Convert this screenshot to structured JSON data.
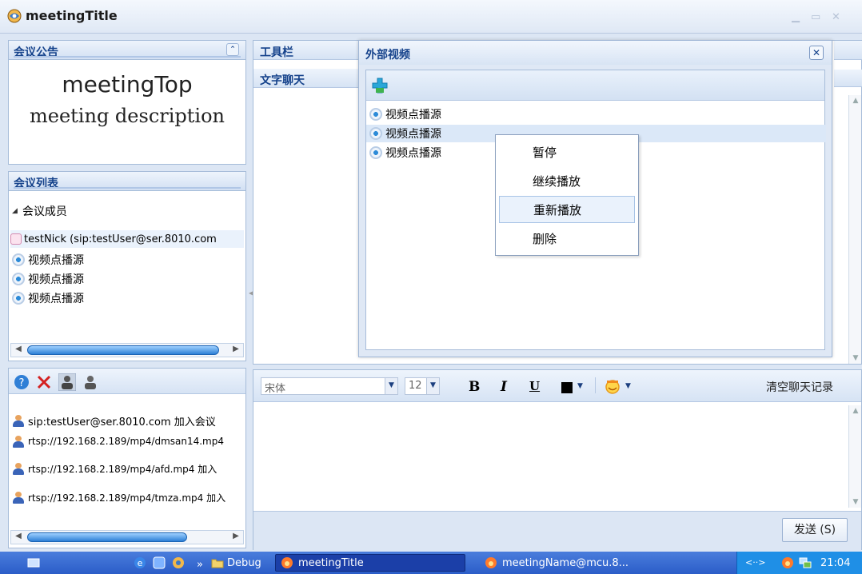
{
  "window": {
    "title": "meetingTitle"
  },
  "announcement": {
    "header": "会议公告",
    "title": "meetingTop",
    "description": "meeting description"
  },
  "meeting_list": {
    "header": "会议列表",
    "group": "会议成员",
    "members": [
      {
        "label": "testNick (sip:testUser@ser.8010.com",
        "type": "user"
      },
      {
        "label": "视频点播源",
        "type": "vod"
      },
      {
        "label": "视频点播源",
        "type": "vod"
      },
      {
        "label": "视频点播源",
        "type": "vod"
      }
    ]
  },
  "log": {
    "entries": [
      "sip:testUser@ser.8010.com 加入会议",
      "rtsp://192.168.2.189/mp4/dmsan14.mp4",
      "rtsp://192.168.2.189/mp4/afd.mp4 加入",
      "rtsp://192.168.2.189/mp4/tmza.mp4 加入"
    ]
  },
  "tabs": {
    "toolbar": "工具栏",
    "chat": "文字聊天"
  },
  "external_video": {
    "title": "外部视频",
    "items": [
      "视频点播源",
      "视频点播源",
      "视频点播源"
    ]
  },
  "context_menu": {
    "items": [
      "暂停",
      "继续播放",
      "重新播放",
      "删除"
    ],
    "active_index": 2
  },
  "format_bar": {
    "font": "宋体",
    "size": "12",
    "bold": "B",
    "italic": "I",
    "underline": "U",
    "clear_history": "清空聊天记录"
  },
  "send_button": "发送 (S)",
  "taskbar": {
    "chevron": "»",
    "debug": "Debug",
    "meeting_title": "meetingTitle",
    "meeting_name": "meetingName@mcu.8...",
    "tray_arrows": "<··>",
    "clock": "21:04"
  },
  "colors": {
    "header_text": "#15428b",
    "panel_border": "#a6bcd9",
    "taskbar_blue": "#2b5dc8",
    "active_task": "#1b3fa8"
  }
}
